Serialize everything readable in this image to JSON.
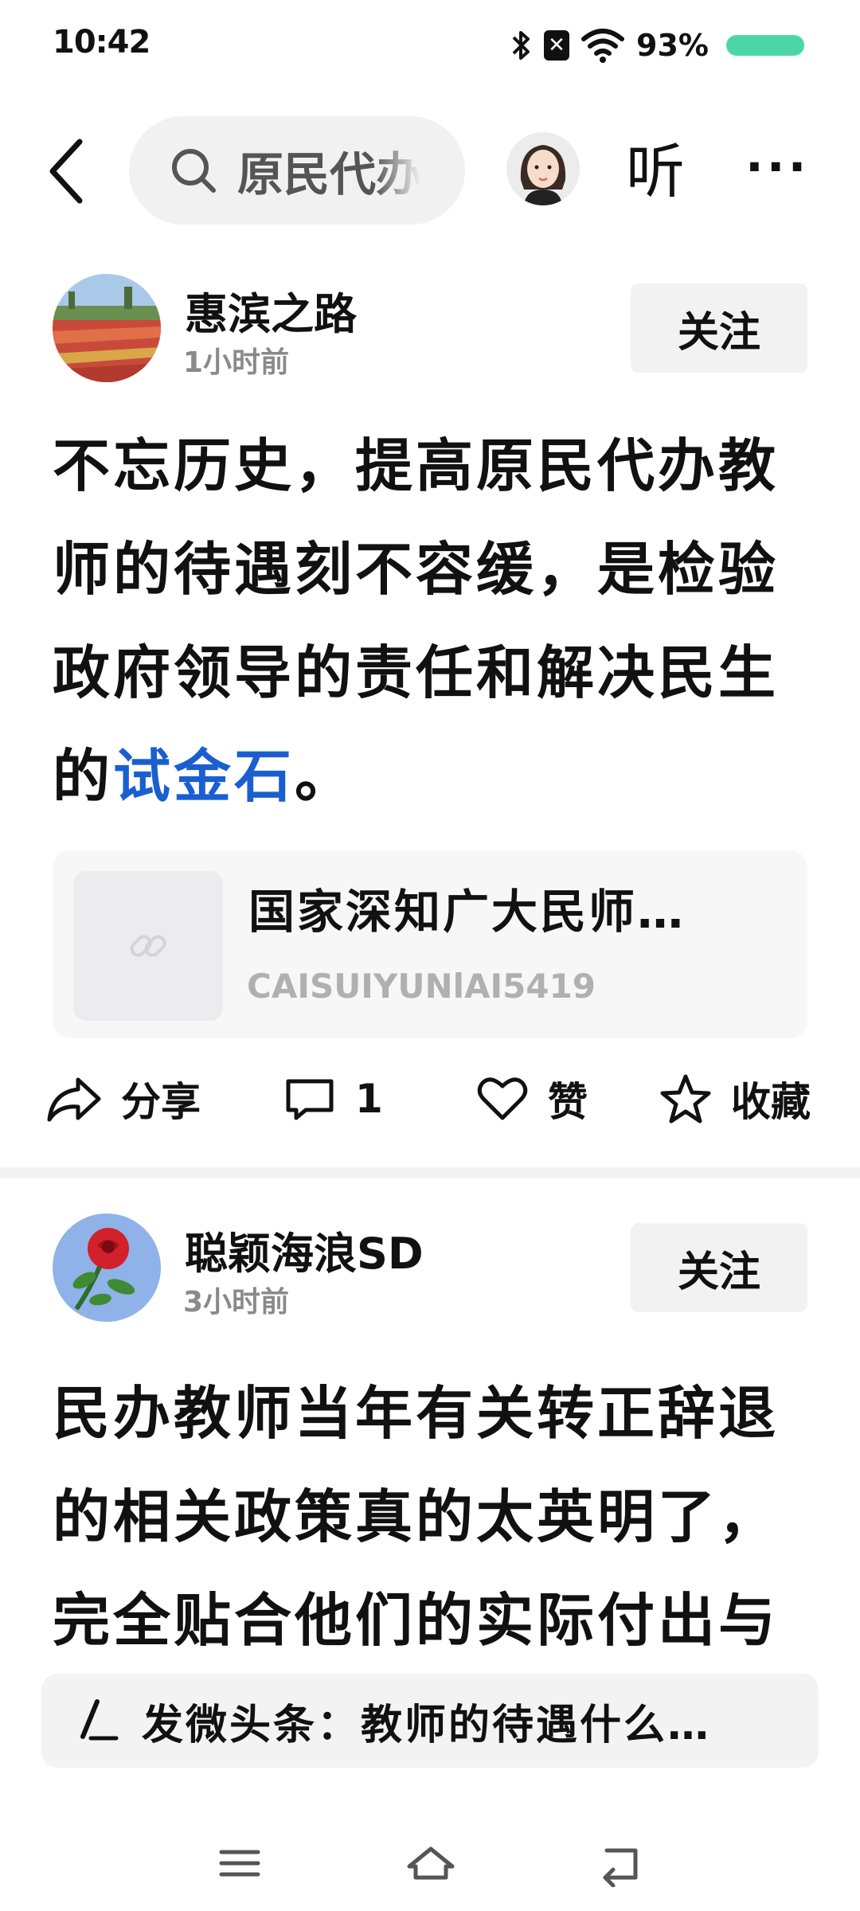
{
  "status_bar": {
    "time": "10:42",
    "battery_percent": "93%",
    "battery_color": "#4cd6a8",
    "icons": [
      "bluetooth-icon",
      "nfc-icon",
      "wifi-icon",
      "battery-icon"
    ]
  },
  "top_nav": {
    "search_text": "原民代办教师",
    "listen_label": "听",
    "more_label": "···"
  },
  "posts": [
    {
      "author": "惠滨之路",
      "time": "1小时前",
      "follow_label": "关注",
      "body_plain": "不忘历史，提高原民代办教师的待遇刻不容缓，是检验政府领导的责任和解决民生的",
      "body_link": "试金石",
      "body_end": "。",
      "link_card": {
        "title": "国家深知广大民师…",
        "source": "CAISUIYUNlAI5419"
      },
      "actions": {
        "share_label": "分享",
        "comment_count": "1",
        "like_label": "赞",
        "favorite_label": "收藏"
      }
    },
    {
      "author": "聪颖海浪SD",
      "time": "3小时前",
      "follow_label": "关注",
      "body_plain": "民办教师当年有关转正辞退的相关政策真的太英明了，完全贴合他们的实际付出与"
    }
  ],
  "composer": {
    "text": "发微头条：教师的待遇什么…"
  },
  "colors": {
    "link_blue": "#1a5fd0",
    "follow_bg": "#f2f2f2",
    "time_gray": "#8a8a8a"
  }
}
